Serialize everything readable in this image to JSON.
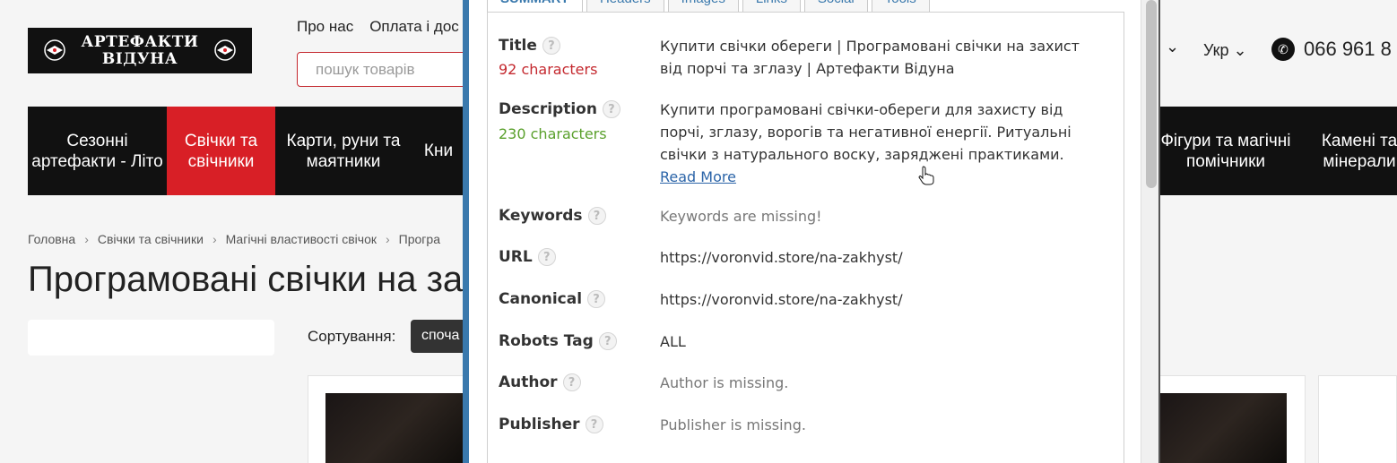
{
  "site": {
    "logo_line1": "АРТЕФАКТИ",
    "logo_line2": "ВІДУНА",
    "toplinks": [
      "Про нас",
      "Оплата і дос"
    ],
    "search_placeholder": "пошук товарів",
    "lang": "Укр",
    "phone": "066 961 8",
    "menu": [
      {
        "label": "Сезонні артефакти - Літо",
        "active": false
      },
      {
        "label": "Свічки та свічники",
        "active": true
      },
      {
        "label": "Карти, руни та маятники",
        "active": false
      },
      {
        "label": "Кни",
        "active": false
      },
      {
        "label": "Фігури та магічні помічники",
        "active": false
      },
      {
        "label": "Камені та мінерали",
        "active": false
      }
    ],
    "breadcrumbs": [
      "Головна",
      "Свічки та свічники",
      "Магічні властивості свічок",
      "Програ"
    ],
    "page_title": "Програмовані свічки на за",
    "sort_label": "Сортування:",
    "sort_value": "споча",
    "accent_color": "#d81f26"
  },
  "panel": {
    "tabs": [
      "SUMMARY",
      "Headers",
      "Images",
      "Links",
      "Social",
      "Tools"
    ],
    "active_tab": "SUMMARY",
    "rows": [
      {
        "label": "Title",
        "sub": "92 characters",
        "sub_color": "red",
        "value": "Купити свічки обереги | Програмовані свічки на захист від порчі та зглазу | Артефакти Відуна"
      },
      {
        "label": "Description",
        "sub": "230 characters",
        "sub_color": "green",
        "value": "Купити програмовані свічки-обереги для захисту від порчі, зглазу, ворогів та негативної енергії. Ритуальні свічки з натурального воску, заряджені практиками.",
        "link": "Read More"
      },
      {
        "label": "Keywords",
        "value": "Keywords are missing!",
        "muted": true
      },
      {
        "label": "URL",
        "value": "https://voronvid.store/na-zakhyst/"
      },
      {
        "label": "Canonical",
        "value": "https://voronvid.store/na-zakhyst/"
      },
      {
        "label": "Robots Tag",
        "value": "ALL"
      },
      {
        "label": "Author",
        "value": "Author is missing.",
        "muted": true
      },
      {
        "label": "Publisher",
        "value": "Publisher is missing.",
        "muted": true
      }
    ],
    "help_icon": "?",
    "link_color": "#2b64a8"
  }
}
